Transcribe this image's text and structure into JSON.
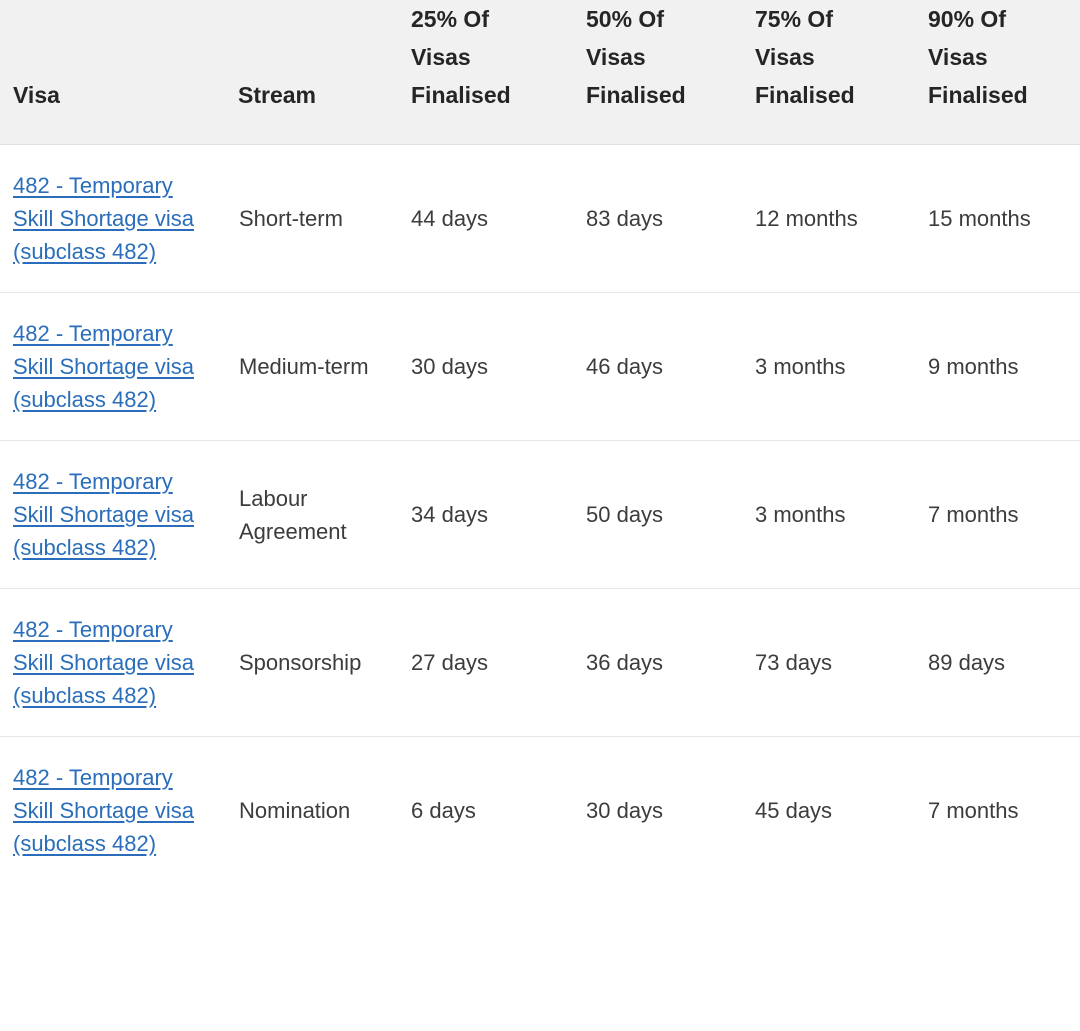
{
  "table": {
    "columns": [
      {
        "key": "visa",
        "label_lines": [
          "Visa"
        ]
      },
      {
        "key": "stream",
        "label_lines": [
          "Stream"
        ]
      },
      {
        "key": "p25",
        "label_lines": [
          "25% Of",
          "Visas",
          "Finalised"
        ]
      },
      {
        "key": "p50",
        "label_lines": [
          "50% Of",
          "Visas",
          "Finalised"
        ]
      },
      {
        "key": "p75",
        "label_lines": [
          "75% Of",
          "Visas",
          "Finalised"
        ]
      },
      {
        "key": "p90",
        "label_lines": [
          "90% Of",
          "Visas",
          "Finalised"
        ]
      }
    ],
    "rows": [
      {
        "visa": "482 - Temporary Skill Shortage visa (subclass 482)",
        "stream": "Short-term",
        "p25": "44 days",
        "p50": "83 days",
        "p75": "12 months",
        "p90": "15 months"
      },
      {
        "visa": "482 - Temporary Skill Shortage visa (subclass 482)",
        "stream": "Medium-term",
        "p25": "30 days",
        "p50": "46 days",
        "p75": "3 months",
        "p90": "9 months"
      },
      {
        "visa": "482 - Temporary Skill Shortage visa (subclass 482)",
        "stream": "Labour Agreement",
        "p25": "34 days",
        "p50": "50 days",
        "p75": "3 months",
        "p90": "7 months"
      },
      {
        "visa": "482 - Temporary Skill Shortage visa (subclass 482)",
        "stream": "Sponsorship",
        "p25": "27 days",
        "p50": "36 days",
        "p75": "73 days",
        "p90": "89 days"
      },
      {
        "visa": "482 - Temporary Skill Shortage visa (subclass 482)",
        "stream": "Nomination",
        "p25": "6 days",
        "p50": "30 days",
        "p75": "45 days",
        "p90": "7 months"
      }
    ]
  },
  "colors": {
    "link": "#2a6ebb",
    "header_background": "#f1f1f1",
    "header_text": "#252525",
    "body_text": "#3c3c3c",
    "row_divider": "#e6e6e6",
    "page_background": "#ffffff"
  }
}
